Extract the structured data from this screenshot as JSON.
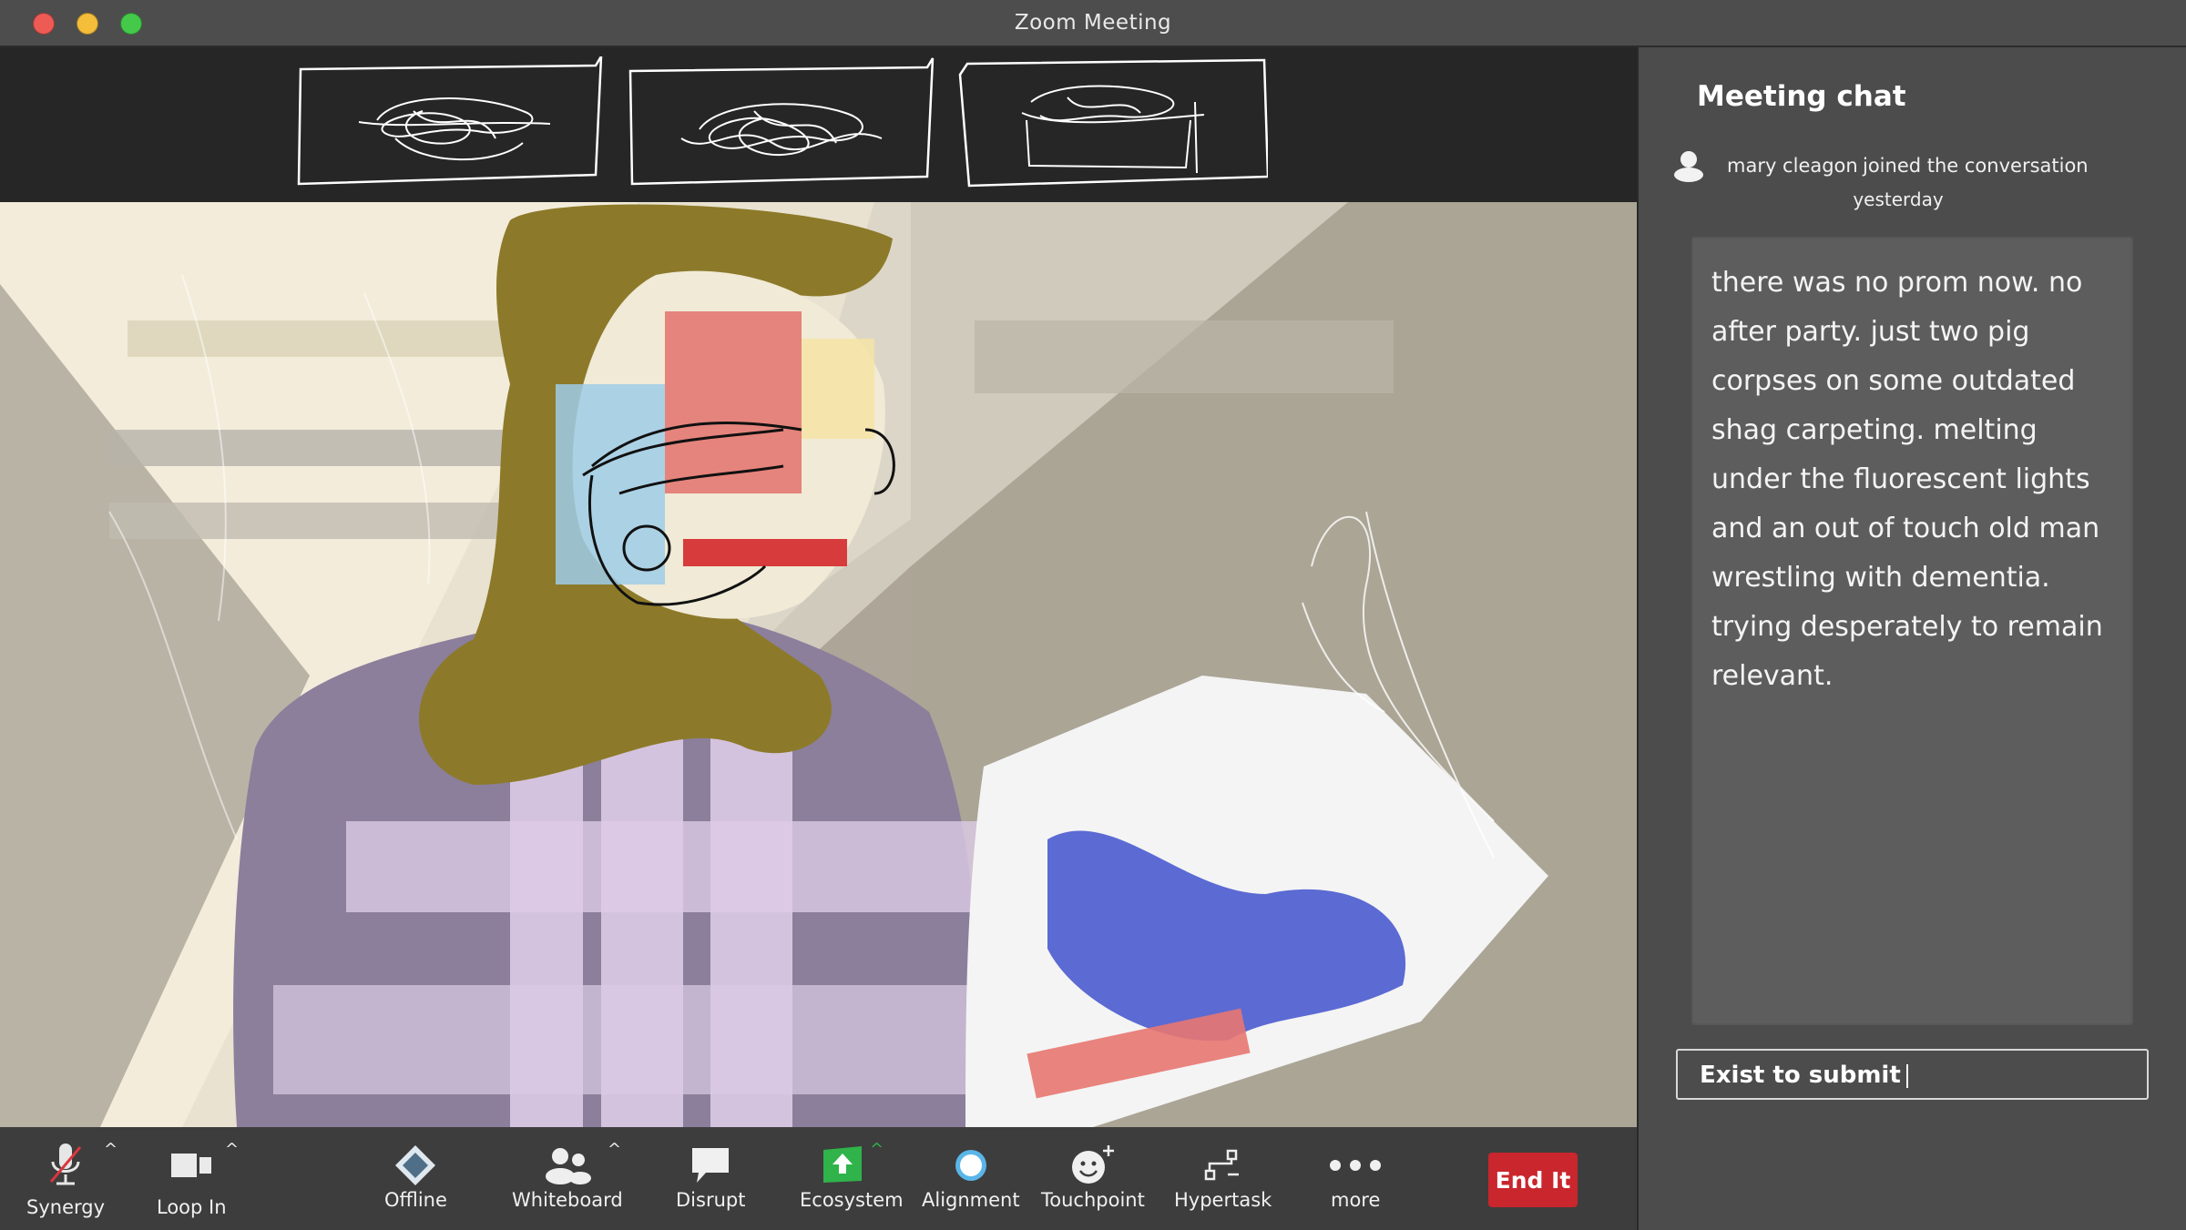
{
  "window": {
    "title": "Zoom Meeting"
  },
  "chat": {
    "title": "Meeting chat",
    "user": "mary cleagon",
    "join_text": "joined the conversation",
    "time": "yesterday",
    "message": "there was no prom now. no after party. just two pig corpses on some outdated shag carpeting. melting under the fluorescent lights and an out of touch old man wrestling with dementia. trying desperately to remain relevant.",
    "input_value": "Exist to submit"
  },
  "toolbar": {
    "items": [
      {
        "label": "Synergy",
        "icon": "microphone-muted-icon"
      },
      {
        "label": "Loop In",
        "icon": "video-camera-icon"
      },
      {
        "label": "Offline",
        "icon": "diamond-icon"
      },
      {
        "label": "Whiteboard",
        "icon": "participants-icon"
      },
      {
        "label": "Disrupt",
        "icon": "speech-bubble-icon"
      },
      {
        "label": "Ecosystem",
        "icon": "share-up-arrow-icon"
      },
      {
        "label": "Alignment",
        "icon": "circle-icon"
      },
      {
        "label": "Touchpoint",
        "icon": "smiley-plus-icon"
      },
      {
        "label": "Hypertask",
        "icon": "flow-icon"
      },
      {
        "label": "more",
        "icon": "more-dots-icon"
      }
    ],
    "end_label": "End It"
  },
  "colors": {
    "accent_red": "#c9262e",
    "share_green": "#2fb34a",
    "panel": "#4c4c4c",
    "bubble": "#5d5d5d"
  }
}
